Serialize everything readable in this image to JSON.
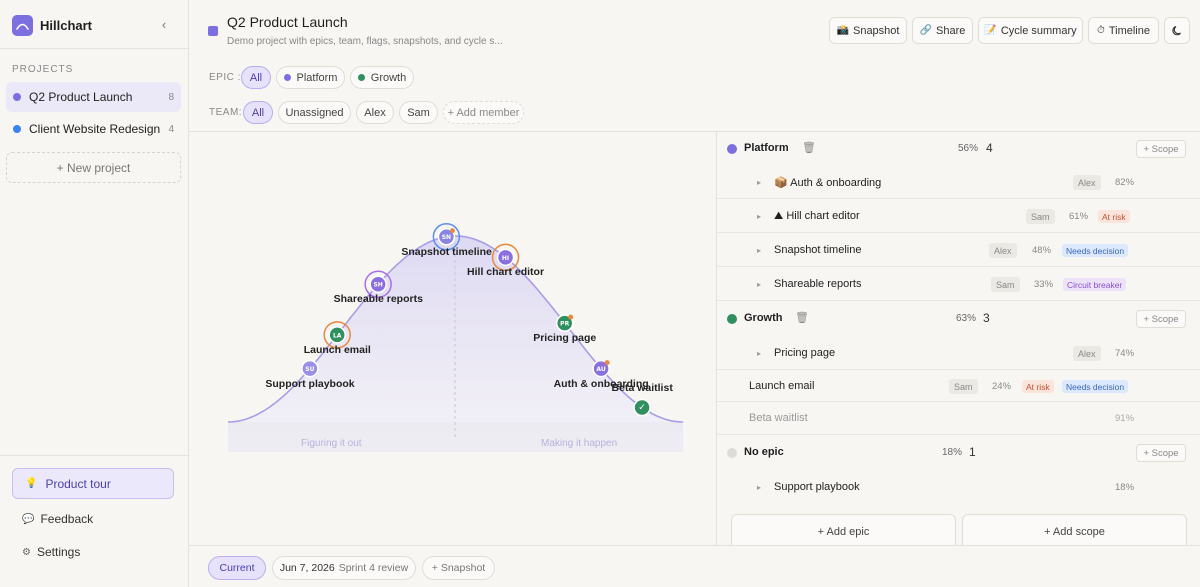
{
  "brand": {
    "name": "Hillchart"
  },
  "sidebar": {
    "section_label": "PROJECTS",
    "projects": [
      {
        "name": "Q2 Product Launch",
        "count": "8",
        "color": "#7c6fe0"
      },
      {
        "name": "Client Website Redesign",
        "count": "4",
        "color": "#3b82f6"
      }
    ],
    "new_project": "+ New project",
    "product_tour": "Product tour",
    "feedback": "Feedback",
    "settings": "Settings"
  },
  "header": {
    "title": "Q2 Product Launch",
    "subtitle": "Demo project with epics, team, flags, snapshots, and cycle s...",
    "buttons": {
      "snapshot": "Snapshot",
      "share": "Share",
      "cycle_summary": "Cycle summary",
      "timeline": "Timeline"
    }
  },
  "filters": {
    "epic_label": "EPIC :",
    "epic_chips": [
      "All",
      "Platform",
      "Growth"
    ],
    "team_label": "TEAM:",
    "team_chips": [
      "All",
      "Unassigned",
      "Alex",
      "Sam",
      "+ Add member"
    ]
  },
  "hill": {
    "phase_left": "Figuring it out",
    "phase_right": "Making it happen",
    "points": [
      {
        "label": "Support playbook",
        "initials": "SU",
        "progress": 18
      },
      {
        "label": "Launch email",
        "initials": "LA",
        "progress": 24
      },
      {
        "label": "Shareable reports",
        "initials": "SH",
        "progress": 33
      },
      {
        "label": "Snapshot timeline",
        "initials": "SN",
        "progress": 48
      },
      {
        "label": "Hill chart editor",
        "initials": "HI",
        "progress": 61
      },
      {
        "label": "Pricing page",
        "initials": "PR",
        "progress": 74
      },
      {
        "label": "Auth & onboarding",
        "initials": "AU",
        "progress": 82
      },
      {
        "label": "Beta waitlist",
        "initials": "✓",
        "progress": 91
      }
    ]
  },
  "panel": {
    "epics": [
      {
        "name": "Platform",
        "color": "#7c6fe0",
        "pct": "56%",
        "count": "4",
        "scope_btn": "+ Scope",
        "scopes": [
          {
            "name": "Auth & onboarding",
            "owner": "Alex",
            "pct": "82%",
            "flags": []
          },
          {
            "name": "Hill chart editor",
            "owner": "Sam",
            "pct": "61%",
            "flags": [
              "At risk"
            ]
          },
          {
            "name": "Snapshot timeline",
            "owner": "Alex",
            "pct": "48%",
            "flags": [
              "Needs decision"
            ]
          },
          {
            "name": "Shareable reports",
            "owner": "Sam",
            "pct": "33%",
            "flags": [
              "Circuit breaker"
            ]
          }
        ]
      },
      {
        "name": "Growth",
        "color": "#2f8f5f",
        "pct": "63%",
        "count": "3",
        "scope_btn": "+ Scope",
        "scopes": [
          {
            "name": "Pricing page",
            "owner": "Alex",
            "pct": "74%",
            "flags": []
          },
          {
            "name": "Launch email",
            "owner": "Sam",
            "pct": "24%",
            "flags": [
              "At risk",
              "Needs decision"
            ]
          },
          {
            "name": "Beta waitlist",
            "owner": "",
            "pct": "91%",
            "flags": []
          }
        ]
      },
      {
        "name": "No epic",
        "color": "#dedcd7",
        "pct": "18%",
        "count": "1",
        "scope_btn": "+ Scope",
        "scopes": [
          {
            "name": "Support playbook",
            "owner": "",
            "pct": "18%",
            "flags": []
          }
        ]
      }
    ],
    "add_epic": "+ Add epic",
    "add_scope": "+ Add scope"
  },
  "bottom": {
    "current": "Current",
    "snapshot_date": "Jun 7, 2026",
    "snapshot_name": "Sprint 4 review",
    "add_snapshot": "+ Snapshot"
  }
}
